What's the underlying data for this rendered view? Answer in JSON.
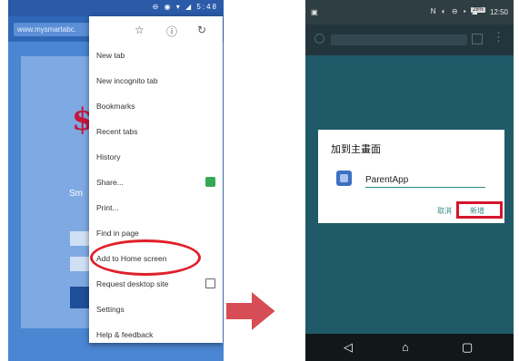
{
  "left_phone": {
    "status_time": "5:48",
    "url": "www.mysmartabc.",
    "page_glyph": "$",
    "page_text": "Sm",
    "menu": {
      "top_icons": [
        "star-icon",
        "info-icon",
        "refresh-icon"
      ],
      "items": [
        {
          "label": "New tab"
        },
        {
          "label": "New incognito tab"
        },
        {
          "label": "Bookmarks"
        },
        {
          "label": "Recent tabs"
        },
        {
          "label": "History"
        },
        {
          "label": "Share..."
        },
        {
          "label": "Print..."
        },
        {
          "label": "Find in page"
        },
        {
          "label": "Add to Home screen"
        },
        {
          "label": "Request desktop site"
        },
        {
          "label": "Settings"
        },
        {
          "label": "Help & feedback"
        }
      ]
    }
  },
  "right_phone": {
    "status_battery": "28%",
    "status_time": "12:50",
    "dialog": {
      "title": "加到主畫面",
      "input_value": "ParentApp",
      "cancel_label": "取消",
      "add_label": "新增"
    },
    "nav_icons": [
      "back-icon",
      "home-icon",
      "recents-icon"
    ]
  },
  "colors": {
    "highlight": "#e0202a",
    "accent": "#2a8a8a",
    "arrow": "#d64d55"
  }
}
